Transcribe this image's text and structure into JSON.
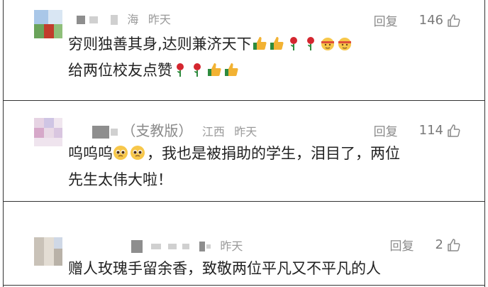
{
  "comments": [
    {
      "location": "海",
      "time": "昨天",
      "reply_label": "回复",
      "likes": "146",
      "lines": [
        "穷则独善其身,达则兼济天下",
        "给两位校友点赞"
      ]
    },
    {
      "name_suffix": "（支教版）",
      "location": "江西",
      "time": "昨天",
      "reply_label": "回复",
      "likes": "114",
      "line1_before": "呜呜呜",
      "line1_after": "，我也是被捐助的学生，泪目了，两位",
      "line2": "先生太伟大啦！"
    },
    {
      "time": "昨天",
      "reply_label": "回复",
      "likes": "2",
      "lines": [
        "赠人玫瑰手留余香，致敬两位平凡又不平凡的人"
      ]
    }
  ],
  "icons": [
    "thumbs-up-icon",
    "rose-icon",
    "pleading-face-icon",
    "like-outline-icon"
  ]
}
